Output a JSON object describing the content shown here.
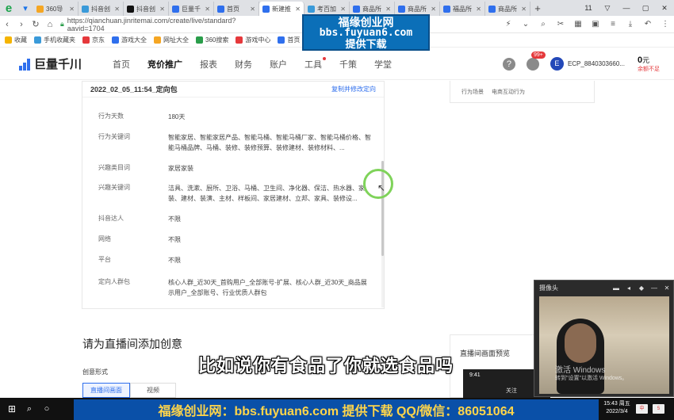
{
  "browser": {
    "tabs": [
      {
        "title": "360导",
        "active": false,
        "color": "#f5a623"
      },
      {
        "title": "抖音创",
        "active": false,
        "color": "#3a9ad9"
      },
      {
        "title": "抖音创",
        "active": false,
        "color": "#111111"
      },
      {
        "title": "巨量千",
        "active": false,
        "color": "#2f6fed"
      },
      {
        "title": "首页",
        "active": false,
        "color": "#2f6fed"
      },
      {
        "title": "新建推",
        "active": true,
        "color": "#2f6fed"
      },
      {
        "title": "考百加",
        "active": false,
        "color": "#3a9ad9"
      },
      {
        "title": "商品所",
        "active": false,
        "color": "#2f6fed"
      },
      {
        "title": "商品所",
        "active": false,
        "color": "#2f6fed"
      },
      {
        "title": "福品所",
        "active": false,
        "color": "#2f6fed"
      },
      {
        "title": "商品所",
        "active": false,
        "color": "#2f6fed"
      }
    ],
    "tab_count": "11",
    "url": "https://qianchuan.jinritemai.com/create/live/standard?aavid=1704",
    "bookmarks": [
      "收藏",
      "手机收藏夹",
      "京东",
      "游戏大全",
      "网址大全",
      "360搜索",
      "游戏中心",
      "首页",
      "抖音企"
    ]
  },
  "watermark": {
    "line1": "福缘创业网",
    "line2": "bbs.fuyuan6.com",
    "line3": "提供下载"
  },
  "app": {
    "logo": "巨量千川",
    "nav": [
      "首页",
      "竞价推广",
      "报表",
      "财务",
      "账户",
      "工具",
      "千策",
      "学堂"
    ],
    "active_nav": "竞价推广",
    "msg_badge": "99+",
    "avatar_letter": "E",
    "account": "ECP_8840303660...",
    "balance": "0",
    "balance_unit": "元",
    "balance_warn": "余额不足"
  },
  "detail": {
    "title": "2022_02_05_11:54_定向包",
    "link": "复制并修改定向",
    "rows": [
      {
        "label": "行为天数",
        "value": "180天"
      },
      {
        "label": "行为关键词",
        "value": "智能家居、智能家居产品、智能马桶、智能马桶厂家、智能马桶价格、智能马桶品牌、马桶、装修、装修预算、装修建材、装修材料、..."
      },
      {
        "label": "兴趣类目词",
        "value": "家居家装"
      },
      {
        "label": "兴趣关键词",
        "value": "洁具、洗漱、厨所、卫浴、马桶、卫生间、净化器、保洁、热水器、家装、建材、装潢、主材、样板间、家居建材、立邦、家具、装修设..."
      },
      {
        "label": "抖音达人",
        "value": "不限"
      },
      {
        "label": "网络",
        "value": "不限"
      },
      {
        "label": "平台",
        "value": "不限"
      },
      {
        "label": "定向人群包",
        "value": "核心人群_近30天_首购用户_全部账号-扩展、核心人群_近30天_商品展示用户_全部账号、行业优质人群包"
      }
    ]
  },
  "side": {
    "label": "行为场景",
    "value": "电商互动行为"
  },
  "creative": {
    "section_title": "请为直播间添加创意",
    "form_label": "创意形式",
    "options": [
      "直播间画面",
      "视频"
    ],
    "preview_title": "直播间画面预览",
    "phone_time": "9:41",
    "phone_follow": "关注"
  },
  "subtitle": "比如说你有食品了你就选食品吗",
  "camera": {
    "title": "摄像头",
    "activate": "激活 Windows",
    "activate_hint": "转到\"设置\"以激活 Windows。"
  },
  "banner": "福缘创业网：bbs.fuyuan6.com  提供下载     QQ/微信：86051064",
  "clock": {
    "time": "15:43 周五",
    "date": "2022/3/4"
  }
}
